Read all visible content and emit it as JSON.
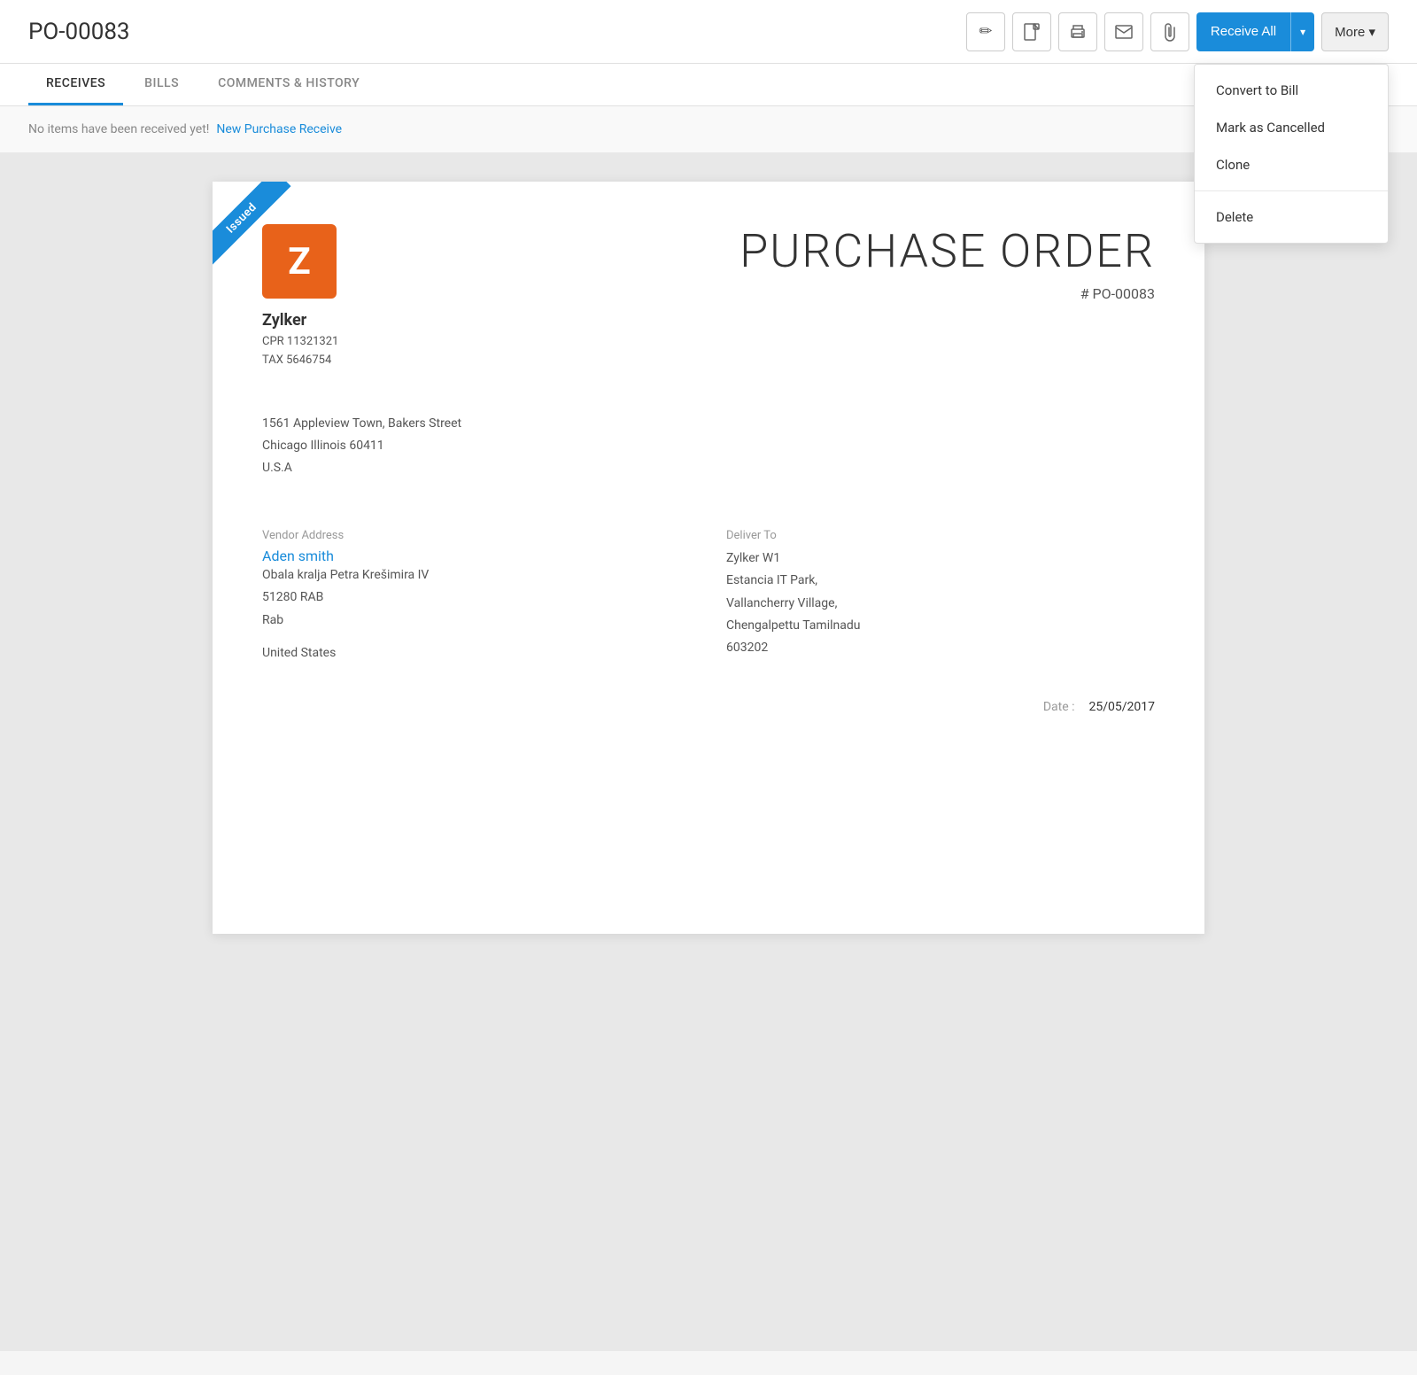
{
  "header": {
    "title": "PO-00083",
    "icons": [
      {
        "name": "edit-icon",
        "symbol": "✏"
      },
      {
        "name": "pdf-icon",
        "symbol": "📄"
      },
      {
        "name": "print-icon",
        "symbol": "🖨"
      },
      {
        "name": "email-icon",
        "symbol": "✉"
      },
      {
        "name": "attachment-icon",
        "symbol": "📎"
      }
    ],
    "receive_all_label": "Receive All",
    "more_label": "More ▾"
  },
  "dropdown": {
    "group1": [
      {
        "label": "Convert to Bill",
        "name": "convert-to-bill"
      },
      {
        "label": "Mark as Cancelled",
        "name": "mark-as-cancelled"
      },
      {
        "label": "Clone",
        "name": "clone"
      }
    ],
    "group2": [
      {
        "label": "Delete",
        "name": "delete"
      }
    ]
  },
  "tabs": [
    {
      "label": "RECEIVES",
      "active": true
    },
    {
      "label": "BILLS",
      "active": false
    },
    {
      "label": "COMMENTS & HISTORY",
      "active": false
    }
  ],
  "empty_state": {
    "message": "No items have been received yet!",
    "link_label": "New Purchase Receive"
  },
  "document": {
    "status": "Issued",
    "title": "PURCHASE ORDER",
    "number": "# PO-00083",
    "company": {
      "logo_letter": "Z",
      "name": "Zylker",
      "cpr": "CPR 11321321",
      "tax": "TAX 5646754",
      "address_line1": "1561 Appleview Town, Bakers Street",
      "address_line2": "Chicago Illinois 60411",
      "address_line3": "U.S.A"
    },
    "vendor": {
      "address_label": "Vendor Address",
      "name": "Aden smith",
      "address_line1": "Obala kralja Petra Krešimira IV",
      "address_line2": "51280 RAB",
      "address_line3": "Rab",
      "address_line4": "",
      "country": "United States"
    },
    "deliver_to": {
      "label": "Deliver To",
      "line1": "Zylker W1",
      "line2": "Estancia IT Park,",
      "line3": "Vallancherry Village,",
      "line4": "Chengalpettu Tamilnadu",
      "line5": "603202"
    },
    "date_label": "Date :",
    "date_value": "25/05/2017"
  }
}
